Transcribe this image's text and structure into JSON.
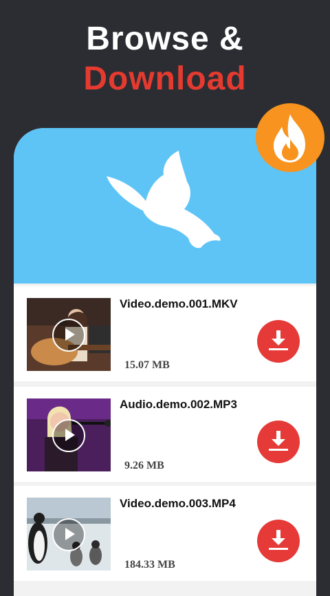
{
  "headline": {
    "line1": "Browse &",
    "line2": "Download"
  },
  "colors": {
    "background": "#2b2d33",
    "accent_red": "#e53a2f",
    "banner_blue": "#5ec4f6",
    "fire_orange": "#f7931e"
  },
  "banner": {
    "icon": "bird-icon"
  },
  "badge": {
    "icon": "fire-icon"
  },
  "downloads": [
    {
      "name": "Video.demo.001.MKV",
      "size": "15.07 MB",
      "thumbnail": "guitar-player-thumbnail"
    },
    {
      "name": "Audio.demo.002.MP3",
      "size": "9.26 MB",
      "thumbnail": "singer-thumbnail"
    },
    {
      "name": "Video.demo.003.MP4",
      "size": "184.33 MB",
      "thumbnail": "penguins-thumbnail"
    }
  ]
}
